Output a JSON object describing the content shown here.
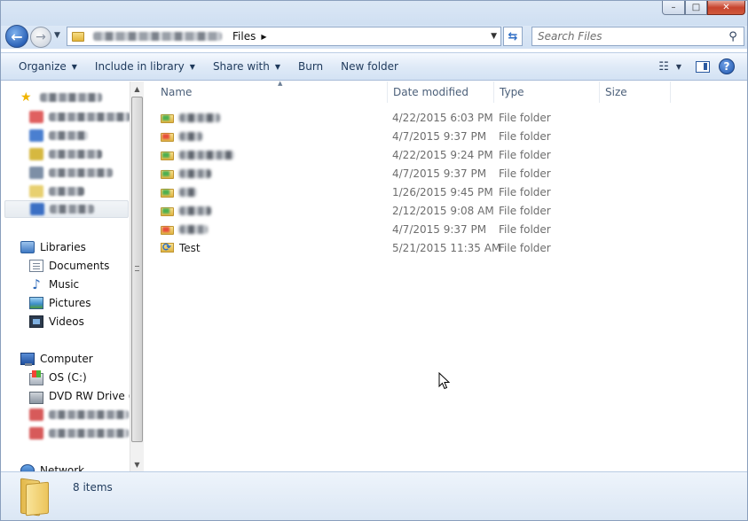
{
  "window": {
    "caption": {
      "minimize": "–",
      "maximize": "□",
      "close": "✕"
    }
  },
  "address_bar": {
    "crumb": "Files",
    "search_placeholder": "Search Files"
  },
  "toolbar": {
    "organize": "Organize",
    "include_in_library": "Include in library",
    "share_with": "Share with",
    "burn": "Burn",
    "new_folder": "New folder"
  },
  "nav_pane": {
    "libraries": "Libraries",
    "library_items": [
      "Documents",
      "Music",
      "Pictures",
      "Videos"
    ],
    "computer": "Computer",
    "computer_items": [
      "OS (C:)",
      "DVD RW Drive (D"
    ],
    "network": "Network"
  },
  "columns": {
    "name": "Name",
    "date_modified": "Date modified",
    "type": "Type",
    "size": "Size"
  },
  "files": [
    {
      "name": "",
      "date": "4/22/2015 6:03 PM",
      "type": "File folder",
      "icon": "folder-icon",
      "tag": "#4caf50"
    },
    {
      "name": "",
      "date": "4/7/2015 9:37 PM",
      "type": "File folder",
      "icon": "folder-icon",
      "tag": "#e74c3c"
    },
    {
      "name": "",
      "date": "4/22/2015 9:24 PM",
      "type": "File folder",
      "icon": "folder-icon",
      "tag": "#4caf50"
    },
    {
      "name": "",
      "date": "4/7/2015 9:37 PM",
      "type": "File folder",
      "icon": "folder-icon",
      "tag": "#4caf50"
    },
    {
      "name": "",
      "date": "1/26/2015 9:45 PM",
      "type": "File folder",
      "icon": "folder-icon",
      "tag": "#4caf50"
    },
    {
      "name": "",
      "date": "2/12/2015 9:08 AM",
      "type": "File folder",
      "icon": "folder-icon",
      "tag": "#4caf50"
    },
    {
      "name": "",
      "date": "4/7/2015 9:37 PM",
      "type": "File folder",
      "icon": "folder-icon",
      "tag": "#e74c3c"
    },
    {
      "name": "Test",
      "date": "5/21/2015 11:35 AM",
      "type": "File folder",
      "icon": "sync-folder-icon",
      "tag": ""
    }
  ],
  "status": {
    "item_count": "8 items"
  },
  "colors": {
    "accent": "#1e395b",
    "meta_text": "#6d6d6d",
    "header_text": "#4c607a"
  }
}
